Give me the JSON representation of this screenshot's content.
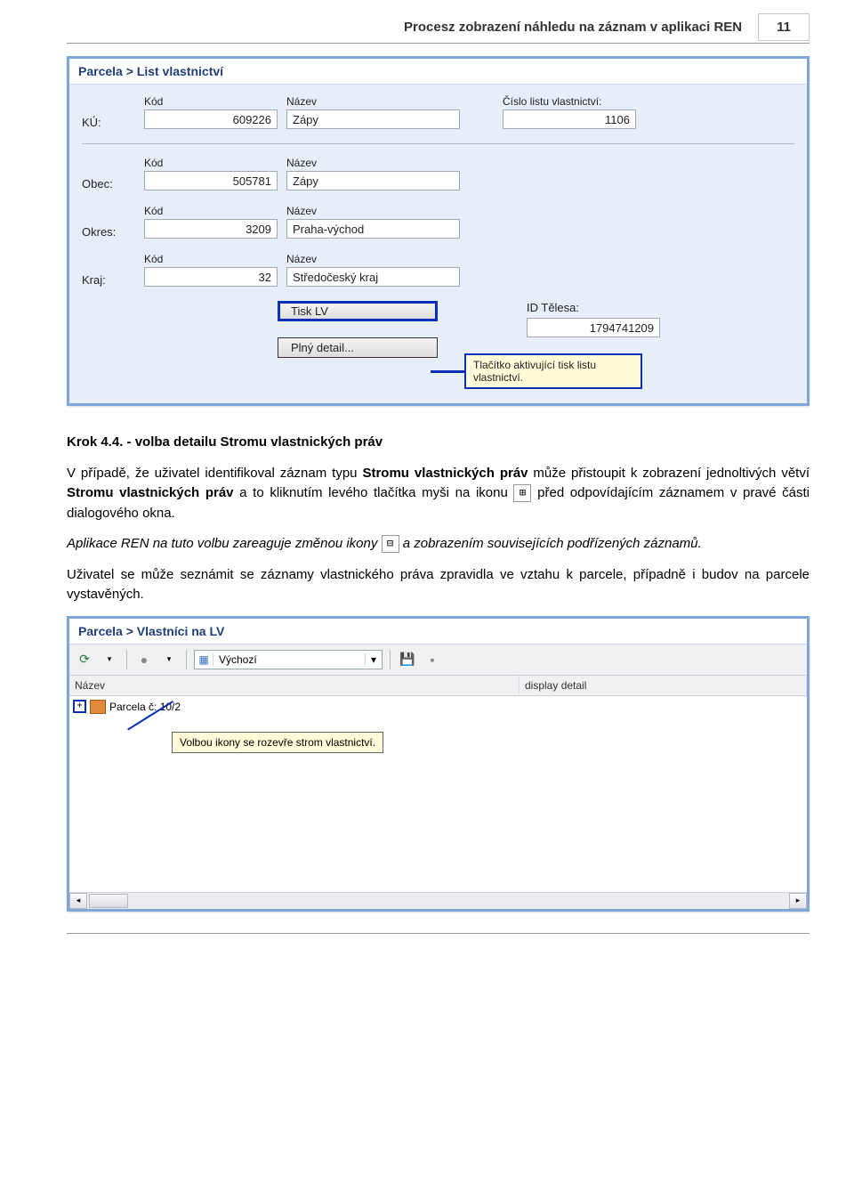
{
  "header": {
    "title": "Procesz zobrazení náhledu na záznam v aplikaci REN",
    "page_num": "11"
  },
  "win1": {
    "title": "Parcela > List vlastnictví",
    "labels": {
      "kod": "Kód",
      "nazev": "Název",
      "clv": "Číslo listu vlastnictví:",
      "ku": "KÚ:",
      "obec": "Obec:",
      "okres": "Okres:",
      "kraj": "Kraj:",
      "id_telesa": "ID Tělesa:"
    },
    "ku": {
      "kod": "609226",
      "nazev": "Zápy"
    },
    "clv": "1106",
    "obec": {
      "kod": "505781",
      "nazev": "Zápy"
    },
    "okres": {
      "kod": "3209",
      "nazev": "Praha-východ"
    },
    "kraj": {
      "kod": "32",
      "nazev": "Středočeský kraj"
    },
    "id_telesa": "1794741209",
    "buttons": {
      "tisk": "Tisk LV",
      "detail": "Plný detail..."
    },
    "callout": "Tlačítko aktivující tisk listu vlastnictví."
  },
  "text": {
    "krok_title": "Krok 4.4. - volba detailu Stromu vlastnických práv",
    "p1a": "V případě, že uživatel identifikoval záznam typu ",
    "p1b": "Stromu vlastnických práv",
    "p1c": "  může přistoupit k zobrazení jednoltivých větví ",
    "p1d": "Stromu vlastnických práv",
    "p1e": " a to kliknutím levého tlačítka myši na ikonu ",
    "p1f": " před odpovídajícím záznamem v pravé části dialogového okna.",
    "p2a": "Aplikace REN na tuto volbu zareaguje změnou ikony ",
    "p2b": " a zobrazením souvisejících podřízených záznamů.",
    "p3": "Uživatel se může seznámit se záznamy vlastnického práva zpravidla ve vztahu k parcele, případně i budov na parcele vystavěných.",
    "icon_plus": "⊞",
    "icon_minus": "⊟"
  },
  "win2": {
    "title": "Parcela > Vlastníci na LV",
    "toolbar": {
      "combo_val": "Výchozí"
    },
    "cols": {
      "nazev": "Název",
      "detail": "display detail"
    },
    "row0": "Parcela č: 10/2",
    "callout": "Volbou ikony se rozevře strom vlastnictví."
  }
}
